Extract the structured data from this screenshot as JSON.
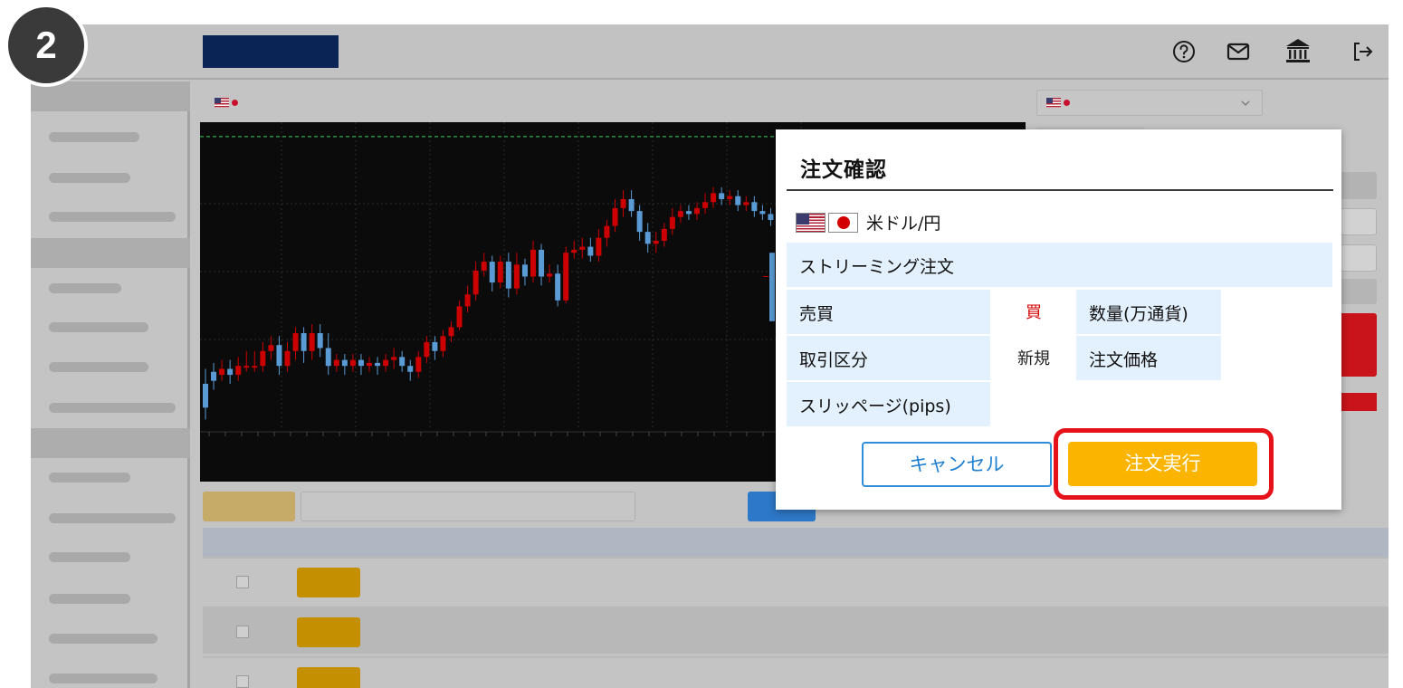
{
  "step": {
    "number": "2"
  },
  "header": {
    "icons": [
      "help-icon",
      "mail-icon",
      "bank-icon",
      "logout-icon"
    ],
    "logo_color": "#0b2456"
  },
  "chart_panel": {
    "pair_flags": [
      "us-flag",
      "jp-flag"
    ]
  },
  "chart_data": {
    "type": "candlestick",
    "title": "",
    "xlabel": "",
    "ylabel": "",
    "up_color": "#cc0000",
    "down_color": "#5b9bd5",
    "candles": [
      [
        0.14,
        0.06,
        0.19,
        0.02
      ],
      [
        0.18,
        0.15,
        0.21,
        0.12
      ],
      [
        0.17,
        0.19,
        0.22,
        0.15
      ],
      [
        0.19,
        0.17,
        0.22,
        0.14
      ],
      [
        0.17,
        0.2,
        0.23,
        0.15
      ],
      [
        0.2,
        0.2,
        0.25,
        0.18
      ],
      [
        0.2,
        0.2,
        0.25,
        0.18
      ],
      [
        0.2,
        0.25,
        0.28,
        0.18
      ],
      [
        0.25,
        0.27,
        0.3,
        0.22
      ],
      [
        0.27,
        0.2,
        0.3,
        0.17
      ],
      [
        0.2,
        0.25,
        0.28,
        0.18
      ],
      [
        0.25,
        0.31,
        0.33,
        0.22
      ],
      [
        0.31,
        0.25,
        0.33,
        0.21
      ],
      [
        0.25,
        0.31,
        0.34,
        0.22
      ],
      [
        0.31,
        0.26,
        0.34,
        0.23
      ],
      [
        0.26,
        0.2,
        0.31,
        0.17
      ],
      [
        0.2,
        0.22,
        0.24,
        0.18
      ],
      [
        0.22,
        0.2,
        0.24,
        0.17
      ],
      [
        0.2,
        0.22,
        0.24,
        0.18
      ],
      [
        0.22,
        0.2,
        0.24,
        0.17
      ],
      [
        0.2,
        0.21,
        0.23,
        0.18
      ],
      [
        0.21,
        0.2,
        0.23,
        0.17
      ],
      [
        0.2,
        0.22,
        0.24,
        0.18
      ],
      [
        0.22,
        0.23,
        0.26,
        0.19
      ],
      [
        0.23,
        0.2,
        0.25,
        0.18
      ],
      [
        0.2,
        0.18,
        0.22,
        0.15
      ],
      [
        0.18,
        0.23,
        0.25,
        0.16
      ],
      [
        0.23,
        0.28,
        0.3,
        0.21
      ],
      [
        0.28,
        0.25,
        0.3,
        0.22
      ],
      [
        0.25,
        0.3,
        0.32,
        0.23
      ],
      [
        0.3,
        0.33,
        0.35,
        0.28
      ],
      [
        0.33,
        0.4,
        0.42,
        0.32
      ],
      [
        0.4,
        0.44,
        0.47,
        0.38
      ],
      [
        0.44,
        0.52,
        0.55,
        0.42
      ],
      [
        0.52,
        0.55,
        0.58,
        0.5
      ],
      [
        0.55,
        0.48,
        0.57,
        0.45
      ],
      [
        0.48,
        0.55,
        0.57,
        0.46
      ],
      [
        0.55,
        0.46,
        0.58,
        0.43
      ],
      [
        0.46,
        0.54,
        0.58,
        0.44
      ],
      [
        0.54,
        0.5,
        0.56,
        0.47
      ],
      [
        0.5,
        0.59,
        0.62,
        0.48
      ],
      [
        0.59,
        0.5,
        0.61,
        0.47
      ],
      [
        0.5,
        0.51,
        0.54,
        0.48
      ],
      [
        0.51,
        0.42,
        0.54,
        0.4
      ],
      [
        0.42,
        0.58,
        0.6,
        0.41
      ],
      [
        0.58,
        0.59,
        0.62,
        0.56
      ],
      [
        0.59,
        0.6,
        0.63,
        0.56
      ],
      [
        0.6,
        0.57,
        0.63,
        0.55
      ],
      [
        0.57,
        0.63,
        0.66,
        0.55
      ],
      [
        0.63,
        0.67,
        0.69,
        0.6
      ],
      [
        0.67,
        0.73,
        0.76,
        0.65
      ],
      [
        0.73,
        0.76,
        0.79,
        0.7
      ],
      [
        0.76,
        0.72,
        0.79,
        0.7
      ],
      [
        0.72,
        0.65,
        0.74,
        0.62
      ],
      [
        0.65,
        0.61,
        0.68,
        0.58
      ],
      [
        0.61,
        0.62,
        0.65,
        0.58
      ],
      [
        0.62,
        0.66,
        0.68,
        0.6
      ],
      [
        0.66,
        0.7,
        0.73,
        0.64
      ],
      [
        0.7,
        0.72,
        0.74,
        0.68
      ],
      [
        0.72,
        0.71,
        0.74,
        0.69
      ],
      [
        0.71,
        0.73,
        0.75,
        0.69
      ],
      [
        0.73,
        0.75,
        0.78,
        0.71
      ],
      [
        0.75,
        0.78,
        0.8,
        0.73
      ],
      [
        0.78,
        0.76,
        0.8,
        0.74
      ],
      [
        0.76,
        0.77,
        0.79,
        0.74
      ],
      [
        0.77,
        0.74,
        0.79,
        0.72
      ],
      [
        0.74,
        0.75,
        0.77,
        0.72
      ],
      [
        0.75,
        0.72,
        0.77,
        0.7
      ],
      [
        0.72,
        0.71,
        0.74,
        0.69
      ],
      [
        0.71,
        0.69,
        0.73,
        0.67
      ],
      [
        0.69,
        0.7,
        0.72,
        0.67
      ],
      [
        0.7,
        0.72,
        0.74,
        0.68
      ],
      [
        0.72,
        0.7,
        0.74,
        0.68
      ]
    ],
    "extra_points": [
      [
        0.4,
        0.35,
        0.58,
        0.3
      ]
    ],
    "ref_line": 0.97
  },
  "dialog": {
    "title": "注文確認",
    "pair_name": "米ドル/円",
    "order_type": "ストリーミング注文",
    "rows": [
      {
        "label": "売買",
        "value": "買",
        "value_color": "#d40000",
        "label2": "数量(万通貨)"
      },
      {
        "label": "取引区分",
        "value": "新規",
        "value_color": "#222222",
        "label2": "注文価格"
      },
      {
        "label": "スリッページ(pips)"
      }
    ],
    "cancel_label": "キャンセル",
    "execute_label": "注文実行",
    "colors": {
      "accent": "#fbb500",
      "cancel": "#2f8fda",
      "highlight": "#e5121a"
    }
  }
}
